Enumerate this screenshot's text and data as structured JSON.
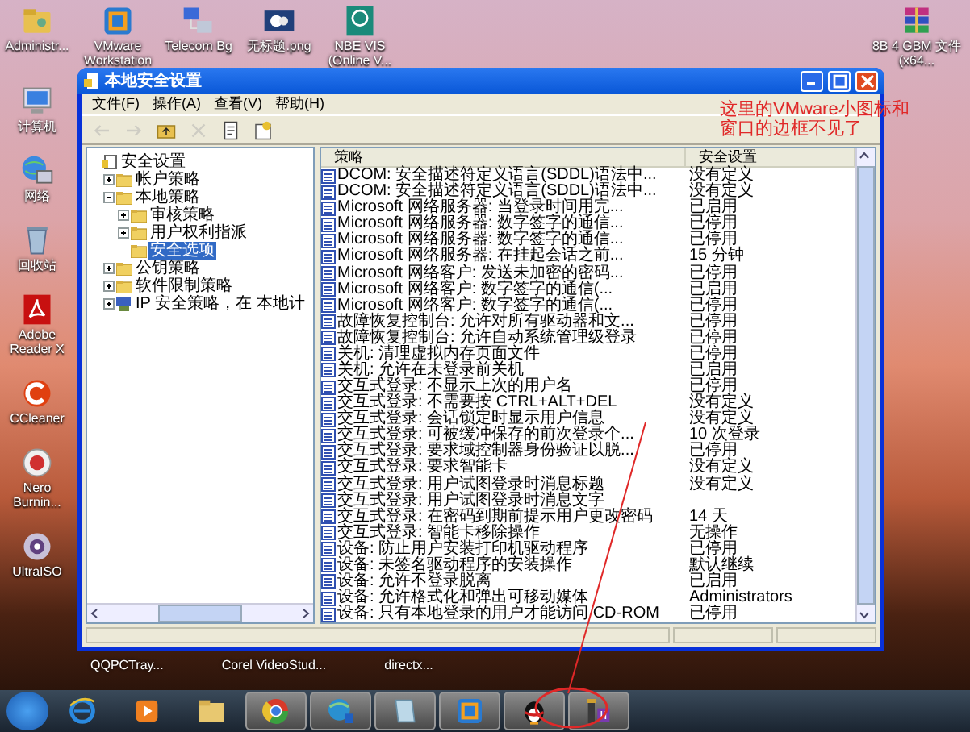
{
  "desktop": {
    "top_icons": [
      {
        "kind": "user-folder",
        "label": "Administr..."
      },
      {
        "kind": "vmware",
        "label": "VMware Workstation"
      },
      {
        "kind": "network-computers",
        "label": "Telecom Bg"
      },
      {
        "kind": "picture",
        "label": "无标题.png"
      },
      {
        "kind": "globe-app",
        "label": "NBE VIS (Online V..."
      }
    ],
    "right_icons": [
      {
        "kind": "archive",
        "label": "8B 4 GBM 文件 (x64..."
      }
    ],
    "left_icons": [
      {
        "kind": "computer",
        "label": "计算机"
      },
      {
        "kind": "network",
        "label": "网络"
      },
      {
        "kind": "recycle-bin",
        "label": "回收站"
      },
      {
        "kind": "pdf",
        "label": "Adobe Reader X"
      },
      {
        "kind": "ccleaner",
        "label": "CCleaner"
      },
      {
        "kind": "nero",
        "label": "Nero Burnin..."
      },
      {
        "kind": "disc",
        "label": "UltraISO"
      }
    ],
    "bottom_labels": [
      "QQPCTray...",
      "Corel VideoStud...",
      "directx..."
    ]
  },
  "window": {
    "title": "本地安全设置",
    "menu": [
      "文件(F)",
      "操作(A)",
      "查看(V)",
      "帮助(H)"
    ],
    "toolbar": [
      {
        "kind": "back",
        "disabled": true
      },
      {
        "kind": "forward",
        "disabled": true
      },
      {
        "kind": "up",
        "disabled": false
      },
      {
        "kind": "delete",
        "disabled": true
      },
      {
        "kind": "export",
        "disabled": false
      },
      {
        "kind": "help",
        "disabled": false
      }
    ],
    "tree": [
      {
        "label": "安全设置",
        "kind": "root",
        "selected": false,
        "children": [
          {
            "label": "帐户策略",
            "kind": "folder",
            "expanded": false,
            "selected": false
          },
          {
            "label": "本地策略",
            "kind": "folder",
            "expanded": true,
            "selected": false,
            "children": [
              {
                "label": "审核策略",
                "kind": "folder",
                "expanded": false,
                "selected": false
              },
              {
                "label": "用户权利指派",
                "kind": "folder",
                "expanded": false,
                "selected": false
              },
              {
                "label": "安全选项",
                "kind": "folder",
                "selected": true
              }
            ]
          },
          {
            "label": "公钥策略",
            "kind": "folder",
            "expanded": false,
            "selected": false
          },
          {
            "label": "软件限制策略",
            "kind": "folder",
            "expanded": false,
            "selected": false
          },
          {
            "label": "IP 安全策略，在 本地计",
            "kind": "ip",
            "expanded": false,
            "selected": false
          }
        ]
      }
    ],
    "table": {
      "columns": [
        "策略",
        "安全设置"
      ],
      "rows": [
        [
          "DCOM: 安全描述符定义语言(SDDL)语法中...",
          "没有定义"
        ],
        [
          "DCOM: 安全描述符定义语言(SDDL)语法中...",
          "没有定义"
        ],
        [
          "Microsoft 网络服务器: 当登录时间用完...",
          "已启用"
        ],
        [
          "Microsoft 网络服务器: 数字签字的通信...",
          "已停用"
        ],
        [
          "Microsoft 网络服务器: 数字签字的通信...",
          "已停用"
        ],
        [
          "Microsoft 网络服务器: 在挂起会话之前...",
          "15 分钟"
        ],
        [
          "Microsoft 网络客户: 发送未加密的密码...",
          "已停用"
        ],
        [
          "Microsoft 网络客户: 数字签字的通信(...",
          "已启用"
        ],
        [
          "Microsoft 网络客户: 数字签字的通信(...",
          "已停用"
        ],
        [
          "故障恢复控制台: 允许对所有驱动器和文...",
          "已停用"
        ],
        [
          "故障恢复控制台: 允许自动系统管理级登录",
          "已停用"
        ],
        [
          "关机: 清理虚拟内存页面文件",
          "已停用"
        ],
        [
          "关机: 允许在未登录前关机",
          "已启用"
        ],
        [
          "交互式登录: 不显示上次的用户名",
          "已停用"
        ],
        [
          "交互式登录: 不需要按 CTRL+ALT+DEL",
          "没有定义"
        ],
        [
          "交互式登录: 会话锁定时显示用户信息",
          "没有定义"
        ],
        [
          "交互式登录: 可被缓冲保存的前次登录个...",
          "10 次登录"
        ],
        [
          "交互式登录: 要求域控制器身份验证以脱...",
          "已停用"
        ],
        [
          "交互式登录: 要求智能卡",
          "没有定义"
        ],
        [
          "交互式登录: 用户试图登录时消息标题",
          "没有定义"
        ],
        [
          "交互式登录: 用户试图登录时消息文字"
        ],
        [
          "交互式登录: 在密码到期前提示用户更改密码",
          "14 天"
        ],
        [
          "交互式登录: 智能卡移除操作",
          "无操作"
        ],
        [
          "设备: 防止用户安装打印机驱动程序",
          "已停用"
        ],
        [
          "设备: 未签名驱动程序的安装操作",
          "默认继续"
        ],
        [
          "设备: 允许不登录脱离",
          "已启用"
        ],
        [
          "设备: 允许格式化和弹出可移动媒体",
          "Administrators"
        ],
        [
          "设备: 只有本地登录的用户才能访问 CD-ROM",
          "已停用"
        ]
      ]
    }
  },
  "annotation": {
    "lines": [
      "这里的VMware小图标和",
      "窗口的边框不见了"
    ]
  },
  "taskbar": {
    "items": [
      {
        "kind": "browser-e",
        "running": false
      },
      {
        "kind": "media",
        "running": false
      },
      {
        "kind": "folder",
        "running": false
      },
      {
        "kind": "round-browser",
        "running": true
      },
      {
        "kind": "globe",
        "running": true
      },
      {
        "kind": "notepad",
        "running": true
      },
      {
        "kind": "vmware",
        "running": true
      },
      {
        "kind": "penguin",
        "running": true
      },
      {
        "kind": "tool",
        "running": true
      }
    ]
  }
}
